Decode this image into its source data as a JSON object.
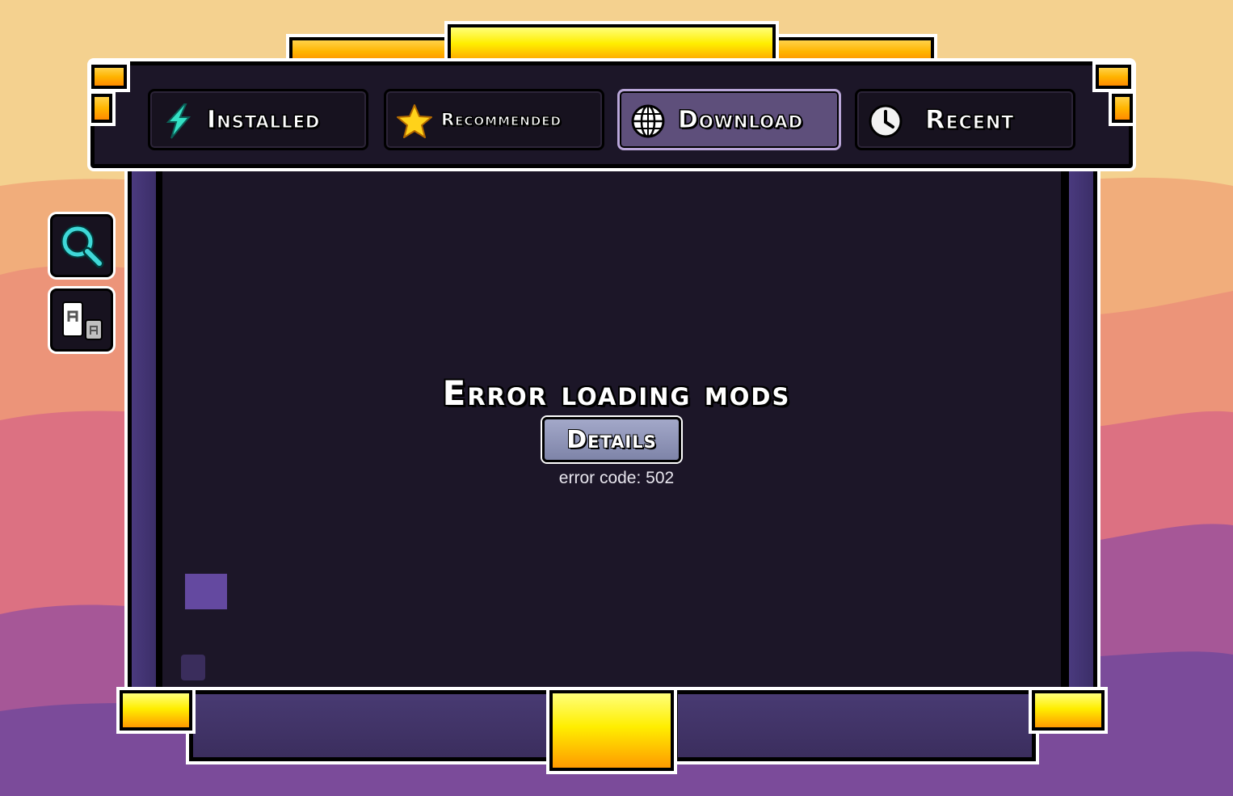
{
  "tabs": [
    {
      "label": "Installed",
      "icon": "download-arrow-icon",
      "active": false
    },
    {
      "label": "Recommended",
      "icon": "star-icon",
      "active": false
    },
    {
      "label": "Download",
      "icon": "globe-icon",
      "active": true
    },
    {
      "label": "Recent",
      "icon": "clock-icon",
      "active": false
    }
  ],
  "side_buttons": [
    {
      "icon": "search-icon"
    },
    {
      "icon": "view-size-icon"
    }
  ],
  "error": {
    "title": "Error loading mods",
    "details_label": "Details",
    "code_text": "error code: 502"
  },
  "colors": {
    "panel": "#1c1628",
    "rail": "#4a3a7e",
    "accent_gold": "#ffee00",
    "active_tab": "#5e4f7b",
    "details_button": "#8d92b6"
  }
}
